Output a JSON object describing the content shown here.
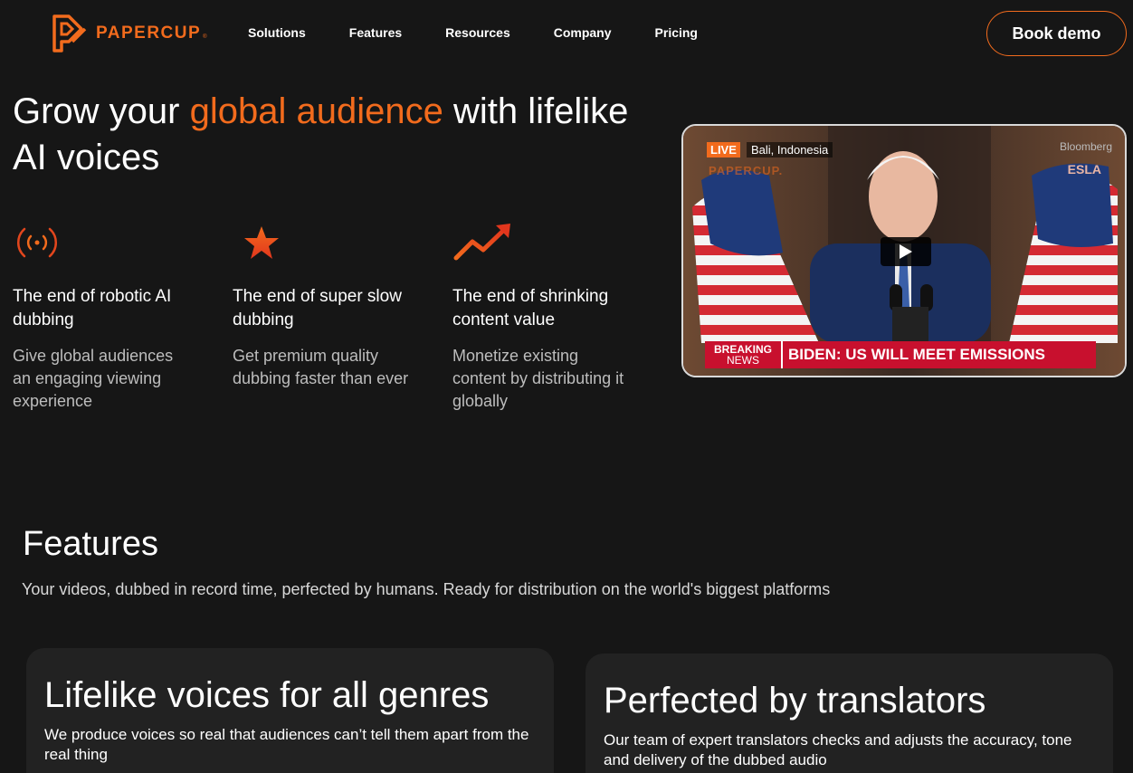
{
  "brand": {
    "name": "PAPERCUP",
    "reg": "®",
    "accent": "#f26b1d"
  },
  "nav": {
    "links": [
      "Solutions",
      "Features",
      "Resources",
      "Company",
      "Pricing"
    ],
    "cta": "Book demo"
  },
  "hero": {
    "title_pre": "Grow your ",
    "title_accent": "global audience",
    "title_post": " with lifelike AI voices"
  },
  "benefits": [
    {
      "icon": "broadcast-icon",
      "title": "The end of robotic AI dubbing",
      "desc": "Give global audiences an engaging viewing experience"
    },
    {
      "icon": "star-icon",
      "title": "The end of super slow dubbing",
      "desc": "Get premium quality dubbing faster than ever"
    },
    {
      "icon": "trend-up-icon",
      "title": "The end of shrinking content value",
      "desc": "Monetize existing content by distributing it globally"
    }
  ],
  "video": {
    "live": "LIVE",
    "location": "Bali, Indonesia",
    "watermark": "PAPERCUP.",
    "channel": "Bloomberg",
    "esla": "ESLA",
    "breaking_1": "BREAKING",
    "breaking_2": "NEWS",
    "headline": "BIDEN: US WILL MEET EMISSIONS TARGET"
  },
  "features": {
    "title": "Features",
    "subtitle": "Your videos, dubbed in record time, perfected by humans. Ready for distribution on the world's biggest platforms"
  },
  "cards": [
    {
      "title": "Lifelike voices for all genres",
      "desc": "We produce voices so real that audiences can’t tell them apart from the real thing"
    },
    {
      "title": "Perfected by translators",
      "desc": "Our team of expert translators checks and adjusts the accuracy, tone and delivery of the dubbed audio"
    }
  ]
}
